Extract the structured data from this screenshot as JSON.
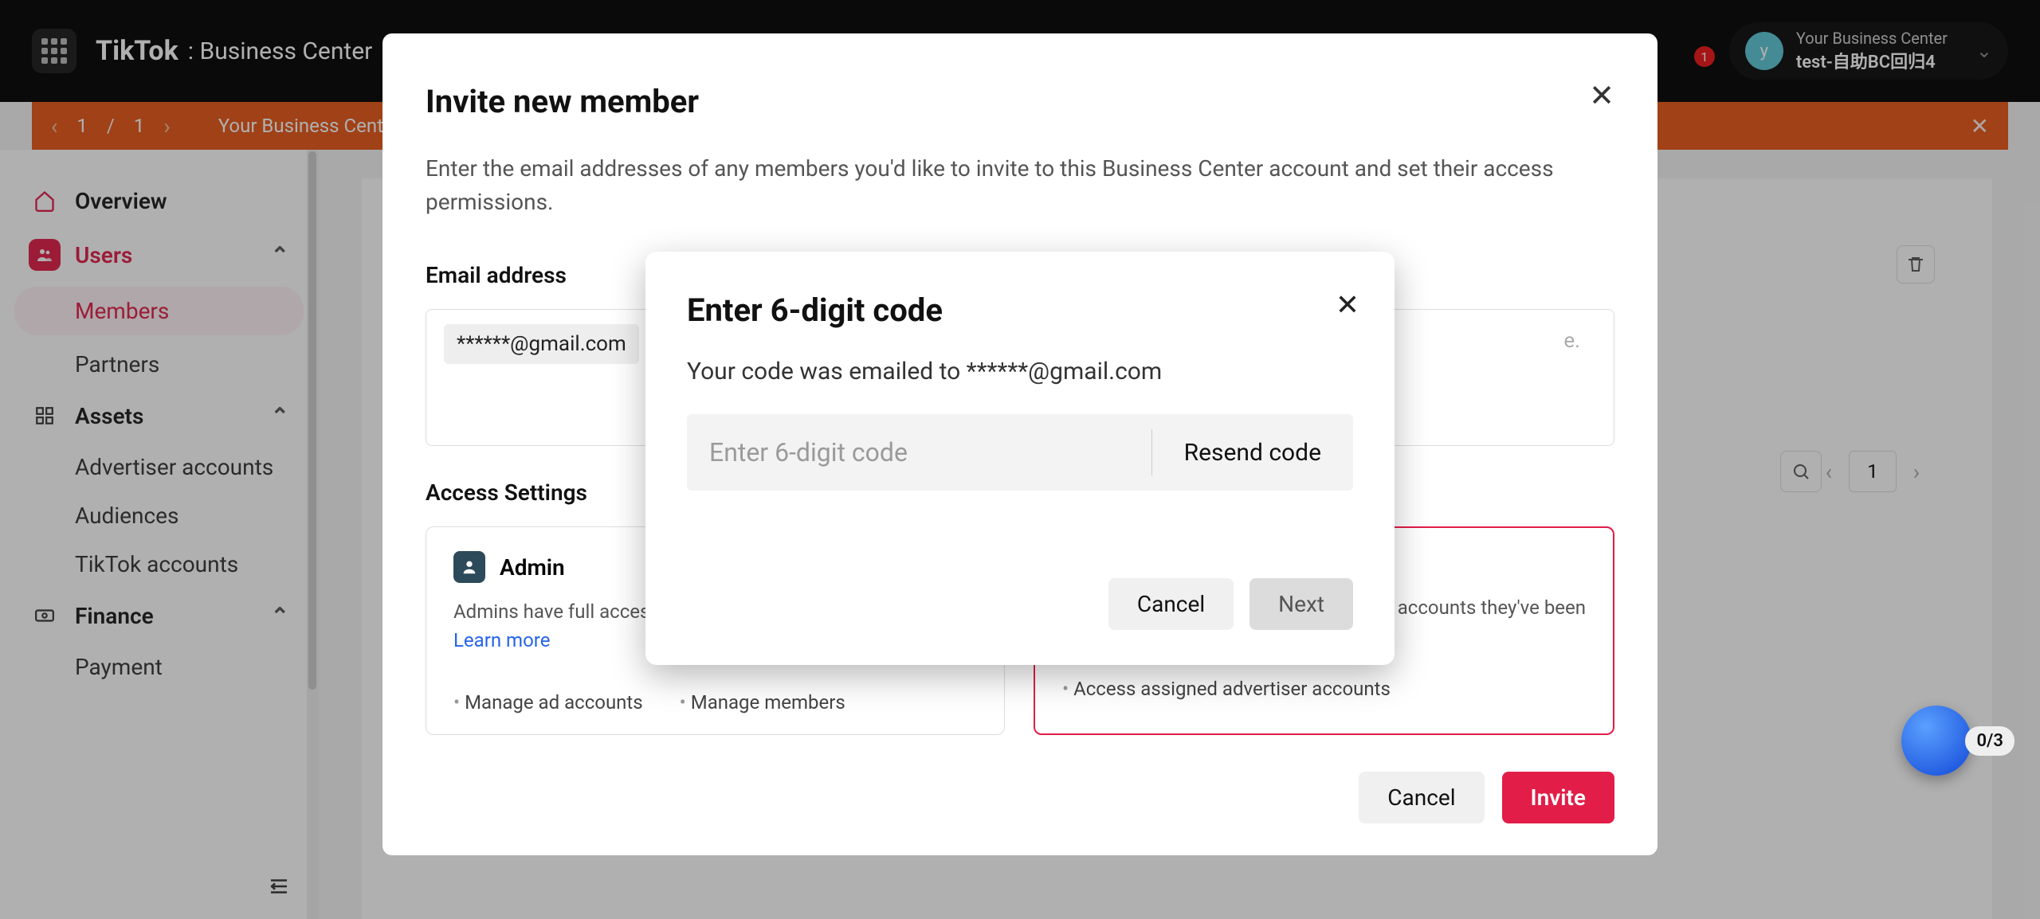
{
  "header": {
    "brand": "TikTok",
    "brand_separator": ":",
    "brand_sub": "Business Center",
    "notif_count": "1",
    "account_line1": "Your Business Center",
    "account_line2": "test-自助BC回归4",
    "avatar_letter": "y"
  },
  "banner": {
    "page_current": "1",
    "page_sep": "/",
    "page_total": "1",
    "crumb": "Your Business Center"
  },
  "sidebar": {
    "overview": "Overview",
    "users": "Users",
    "members": "Members",
    "partners": "Partners",
    "assets": "Assets",
    "adv_accounts": "Advertiser accounts",
    "audiences": "Audiences",
    "tiktok_accounts": "TikTok accounts",
    "finance": "Finance",
    "payment": "Payment"
  },
  "main": {
    "page_number": "1"
  },
  "invite": {
    "title": "Invite new member",
    "desc": "Enter the email addresses of any members you'd like to invite to this Business Center account and set their access permissions.",
    "email_label": "Email address",
    "email_chip": "******@gmail.com",
    "email_placeholder_tail": "e.",
    "access_label": "Access Settings",
    "admin_title": "Admin",
    "admin_desc_prefix": "Admins have full access",
    "learn_more": "Learn more",
    "standard_desc_tail": "accounts they've been",
    "feat_manage_ad": "Manage ad accounts",
    "feat_manage_members": "Manage members",
    "feat_access_assigned": "Access assigned advertiser accounts",
    "cancel": "Cancel",
    "invite_btn": "Invite"
  },
  "code": {
    "title": "Enter 6-digit code",
    "desc_prefix": "Your code was emailed to ",
    "desc_email": "******@gmail.com",
    "input_placeholder": "Enter 6-digit code",
    "resend": "Resend code",
    "cancel": "Cancel",
    "next": "Next"
  },
  "fab": {
    "counter": "0/3"
  }
}
